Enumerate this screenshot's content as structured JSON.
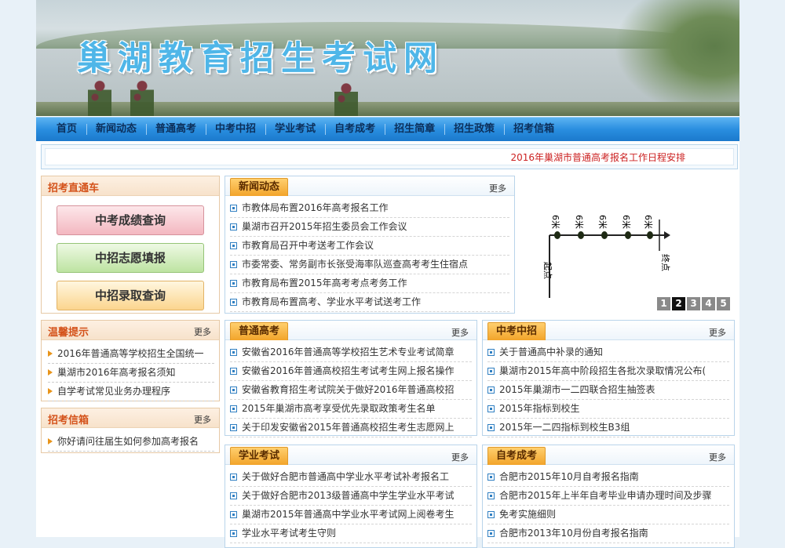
{
  "site_title": "巢湖教育招生考试网",
  "nav": [
    "首页",
    "新闻动态",
    "普通高考",
    "中考中招",
    "学业考试",
    "自考成考",
    "招生简章",
    "招生政策",
    "招考信箱"
  ],
  "ticker_text": "2016年巢湖市普通高考报名工作日程安排",
  "zhitongche": {
    "title": "招考直通车",
    "buttons": [
      "中考成绩查询",
      "中招志愿填报",
      "中招录取查询"
    ]
  },
  "tips": {
    "title": "温馨提示",
    "more": "更多",
    "items": [
      "2016年普通高等学校招生全国统一",
      "巢湖市2016年高考报名须知",
      "自学考试常见业务办理程序"
    ]
  },
  "mailbox": {
    "title": "招考信箱",
    "more": "更多",
    "items": [
      "你好请问往届生如何参加高考报名"
    ]
  },
  "news": {
    "title": "新闻动态",
    "more": "更多",
    "items": [
      "市教体局布置2016年高考报名工作",
      "巢湖市召开2015年招生委员会工作会议",
      "市教育局召开中考送考工作会议",
      "市委常委、常务副市长张受海率队巡查高考考生住宿点",
      "市教育局布置2015年高考考点考务工作",
      "市教育局布置高考、学业水平考试送考工作"
    ]
  },
  "slideshow": {
    "labels": [
      "6米",
      "6米",
      "6米",
      "6米",
      "6米"
    ],
    "start": "起点",
    "end": "终点",
    "pages": [
      "1",
      "2",
      "3",
      "4",
      "5"
    ],
    "active_page": "2"
  },
  "gaokao": {
    "title": "普通高考",
    "more": "更多",
    "items": [
      "安徽省2016年普通高等学校招生艺术专业考试简章",
      "安徽省2016年普通高校招生考试考生网上报名操作",
      "安徽省教育招生考试院关于做好2016年普通高校招",
      "2015年巢湖市高考享受优先录取政策考生名单",
      "关于印发安徽省2015年普通高校招生考生志愿网上"
    ]
  },
  "zhongkao": {
    "title": "中考中招",
    "more": "更多",
    "items": [
      "关于普通高中补录的通知",
      "巢湖市2015年高中阶段招生各批次录取情况公布(",
      "2015年巢湖市一二四联合招生抽签表",
      "2015年指标到校生",
      "2015年一二四指标到校生B3组"
    ]
  },
  "xueye": {
    "title": "学业考试",
    "more": "更多",
    "items": [
      "关于做好合肥市普通高中学业水平考试补考报名工",
      "关于做好合肥市2013级普通高中学生学业水平考试",
      "巢湖市2015年普通高中学业水平考试网上阅卷考生",
      "学业水平考试考生守则"
    ]
  },
  "zikao": {
    "title": "自考成考",
    "more": "更多",
    "items": [
      "合肥市2015年10月自考报名指南",
      "合肥市2015年上半年自考毕业申请办理时间及步骤",
      "免考实施细则",
      "合肥市2013年10月份自考报名指南"
    ]
  },
  "colors": {
    "accent": "#2a8ee0",
    "tab": "#f2a42a",
    "ticker": "#cc2222",
    "left_title": "#d4521a"
  }
}
